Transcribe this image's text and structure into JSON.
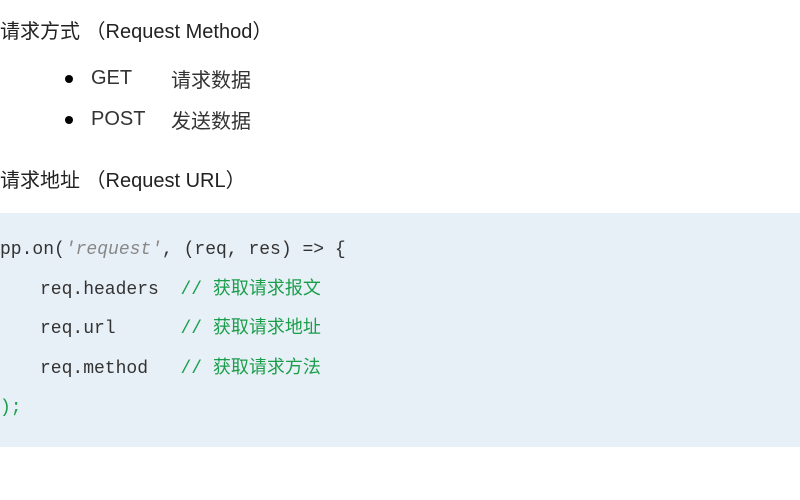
{
  "section1": {
    "title": "请求方式 （Request Method）",
    "items": [
      {
        "name": "GET",
        "desc": "请求数据"
      },
      {
        "name": "POST",
        "desc": "发送数据"
      }
    ]
  },
  "section2": {
    "title": "请求地址 （Request URL）"
  },
  "code": {
    "line1_pre": "pp.on(",
    "line1_str": "'request'",
    "line1_post": ", (req, res) => {",
    "line2_prop": "req.headers",
    "line2_comment": "// 获取请求报文",
    "line3_prop": "req.url",
    "line3_comment": "// 获取请求地址",
    "line4_prop": "req.method",
    "line4_comment": "// 获取请求方法",
    "line5": ");"
  }
}
